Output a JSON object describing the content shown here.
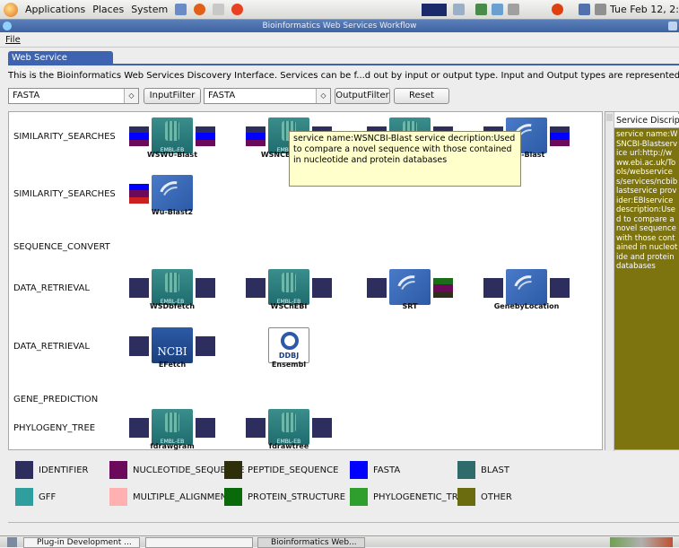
{
  "topbar": {
    "menus": [
      "Applications",
      "Places",
      "System"
    ],
    "clock": "Tue Feb 12,  2:11 AM"
  },
  "window": {
    "title": "Bioinformatics Web Services Workflow"
  },
  "menubar": {
    "file": "File"
  },
  "tab": {
    "label": "Web Service Discoveray"
  },
  "intro": "This is the Bioinformatics Web Services Discovery Interface. Services can be f...d out by input or output type. Input and Output types are represented by colors i",
  "controls": {
    "input_type": "FASTA",
    "input_filter": "InputFilter",
    "output_type": "FASTA",
    "output_filter": "OutputFilter",
    "reset": "Reset"
  },
  "rows": [
    {
      "label": "SIMILARITY_SEARCHES",
      "services": [
        {
          "name": "WSWU-Blast",
          "icon": "embl-icon",
          "in": [
            "#2e2e5e",
            "#0000ff",
            "#6b0a5a"
          ],
          "out": [
            "#2e2e5e",
            "#0000ff",
            "#6b0a5a"
          ]
        },
        {
          "name": "WSNCBI-Blast",
          "icon": "embl-icon",
          "in": [
            "#2e2e5e",
            "#0000ff",
            "#6b0a5a"
          ],
          "out": [
            "#2e2e5e",
            "#0000ff",
            "#6b0a5a"
          ]
        },
        {
          "name": "PSIPHI-Blast",
          "icon": "embl-icon",
          "in": [
            "#2e2e5e",
            "#0000ff",
            "#6b0a5a"
          ],
          "out": [
            "#2e2e5e",
            "#0000ff",
            "#6b0a5a"
          ]
        },
        {
          "name": "Wu-Blast",
          "icon": "blast-icon",
          "in": [
            "#2e2e5e",
            "#0000ff",
            "#6b0a5a"
          ],
          "out": [
            "#2e2e5e",
            "#0000ff",
            "#6b0a5a"
          ]
        }
      ]
    },
    {
      "label": "SIMILARITY_SEARCHES",
      "services": [
        {
          "name": "Wu-Blast2",
          "icon": "blast-icon",
          "in": [
            "#0000ff",
            "#6b0a5a",
            "#cc2020"
          ],
          "out": []
        }
      ]
    },
    {
      "label": "SEQUENCE_CONVERT",
      "services": []
    },
    {
      "label": "DATA_RETRIEVAL",
      "services": [
        {
          "name": "WSDbfetch",
          "icon": "embl-icon",
          "in": [
            "#2e2e5e",
            "#2e2e5e",
            "#2e2e5e"
          ],
          "out": [
            "#2e2e5e",
            "#2e2e5e",
            "#2e2e5e"
          ]
        },
        {
          "name": "WSChEBI",
          "icon": "embl-icon",
          "in": [
            "#2e2e5e",
            "#2e2e5e",
            "#2e2e5e"
          ],
          "out": [
            "#2e2e5e",
            "#2e2e5e",
            "#2e2e5e"
          ]
        },
        {
          "name": "SRT",
          "icon": "blast-icon",
          "in": [
            "#2e2e5e",
            "#2e2e5e",
            "#2e2e5e"
          ],
          "out": [
            "#1a6e1a",
            "#6b0a5a",
            "#2e2e1a"
          ]
        },
        {
          "name": "GenebyLocation",
          "icon": "blast-icon",
          "in": [
            "#2e2e5e",
            "#2e2e5e",
            "#2e2e5e"
          ],
          "out": [
            "#2e2e5e",
            "#2e2e5e",
            "#2e2e5e"
          ]
        }
      ]
    },
    {
      "label": "DATA_RETRIEVAL",
      "services": [
        {
          "name": "EFetch",
          "icon": "ncbi-icon",
          "in": [
            "#2e2e5e",
            "#2e2e5e",
            "#2e2e5e"
          ],
          "out": [
            "#2e2e5e",
            "#2e2e5e",
            "#2e2e5e"
          ]
        },
        {
          "name": "Ensembl",
          "icon": "ddbj-icon",
          "in": [],
          "out": []
        }
      ]
    },
    {
      "label": "GENE_PREDICTION",
      "services": []
    },
    {
      "label": "PHYLOGENY_TREE",
      "services": [
        {
          "name": "fdrawgram",
          "icon": "embl-icon",
          "in": [
            "#2e2e5e",
            "#2e2e5e",
            "#2e2e5e"
          ],
          "out": [
            "#2e2e5e",
            "#2e2e5e",
            "#2e2e5e"
          ]
        },
        {
          "name": "fdrawtree",
          "icon": "embl-icon",
          "in": [
            "#2e2e5e",
            "#2e2e5e",
            "#2e2e5e"
          ],
          "out": [
            "#2e2e5e",
            "#2e2e5e",
            "#2e2e5e"
          ]
        }
      ]
    }
  ],
  "tooltip": "service name:WSNCBI-Blast service decription:Used to compare a novel sequence with those contained in nucleotide and protein databases",
  "description": {
    "header": "Service Discription",
    "body": "service name:WSNCBI-Blastservice url:http://www.ebi.ac.uk/Tools/webservices/services/ncbiblastservice provider:EBIservice description:Used to compare a novel sequence with those contained in nucleotide and protein databases"
  },
  "legend": [
    {
      "label": "IDENTIFIER",
      "color": "#2e2e5e"
    },
    {
      "label": "NUCLEOTIDE_SEQUENCE",
      "color": "#6b0a5a"
    },
    {
      "label": "PEPTIDE_SEQUENCE",
      "color": "#2e2e0a"
    },
    {
      "label": "FASTA",
      "color": "#0000ff"
    },
    {
      "label": "BLAST",
      "color": "#2f6b6b"
    },
    {
      "label": "GFF",
      "color": "#2f9e9e"
    },
    {
      "label": "MULTIPLE_ALIGNMENT",
      "color": "#ffb0b0"
    },
    {
      "label": "PROTEIN_STRUCTURE",
      "color": "#0a6a0a"
    },
    {
      "label": "PHYLOGENETIC_TREE",
      "color": "#2e9e2e"
    },
    {
      "label": "OTHER",
      "color": "#6b6b10"
    }
  ],
  "taskbar": {
    "task1": "Plug-in Development ...",
    "task2": "",
    "task3": "Bioinformatics Web..."
  }
}
